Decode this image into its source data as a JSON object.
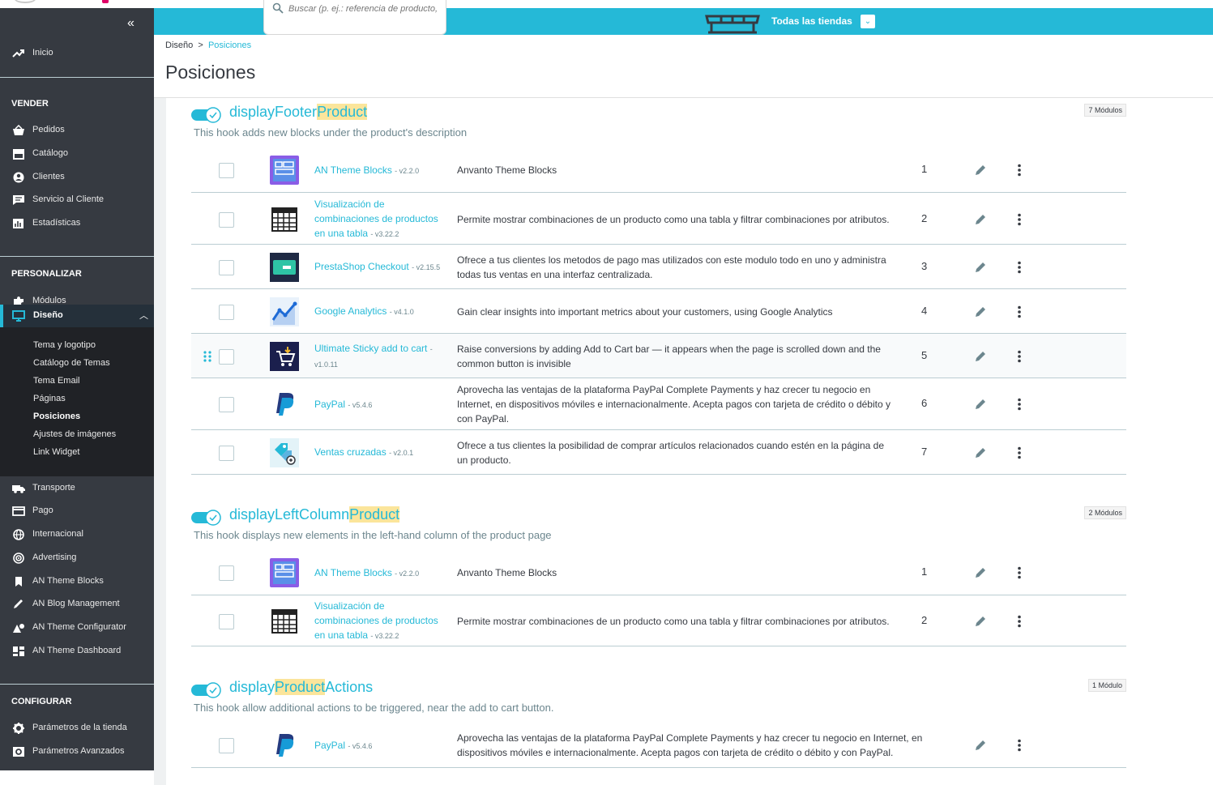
{
  "search": {
    "placeholder": "Buscar (p. ej.: referencia de producto,"
  },
  "header": {
    "shop_label": "Todas las tiendas",
    "shop_dropdown": "⌄"
  },
  "sidebar": {
    "collapse": "«",
    "home": "Inicio",
    "sections": {
      "sell": "VENDER",
      "customize": "PERSONALIZAR",
      "configure": "CONFIGURAR"
    },
    "sell_items": [
      "Pedidos",
      "Catálogo",
      "Clientes",
      "Servicio al Cliente",
      "Estadísticas"
    ],
    "customize_items": [
      "Módulos",
      "Diseño"
    ],
    "design_sub": [
      "Tema y logotipo",
      "Catálogo de Temas",
      "Tema Email",
      "Páginas",
      "Posiciones",
      "Ajustes de imágenes",
      "Link Widget"
    ],
    "other_items": [
      "Transporte",
      "Pago",
      "Internacional",
      "Advertising",
      "AN Theme Blocks",
      "AN Blog Management",
      "AN Theme Configurator",
      "AN Theme Dashboard"
    ],
    "configure_items": [
      "Parámetros de la tienda",
      "Parámetros Avanzados"
    ]
  },
  "breadcrumb": {
    "parent": "Diseño",
    "sep": ">",
    "current": "Posiciones"
  },
  "page_title": "Posiciones",
  "hooks": [
    {
      "name_pre": "displayFooter",
      "name_hl": "Product",
      "name_post": "",
      "desc": "This hook adds new blocks under the product's description",
      "badge": "7 Módulos",
      "rows": [
        {
          "name": "AN Theme Blocks",
          "ver": "- v2.2.0",
          "desc": "Anvanto Theme Blocks",
          "pos": "1",
          "icon": "an-theme-blocks"
        },
        {
          "name": "Visualización de combinaciones de productos en una tabla",
          "ver": "- v3.22.2",
          "desc": "Permite mostrar combinaciones de un producto como una tabla y filtrar combinaciones por atributos.",
          "pos": "2",
          "icon": "table-grid"
        },
        {
          "name": "PrestaShop Checkout",
          "ver": "- v2.15.5",
          "desc": "Ofrece a tus clientes los metodos de pago mas utilizados con este modulo todo en uno y administra todas tus ventas en una interfaz centralizada.",
          "pos": "3",
          "icon": "checkout-card"
        },
        {
          "name": "Google Analytics",
          "ver": "- v4.1.0",
          "desc": "Gain clear insights into important metrics about your customers, using Google Analytics",
          "pos": "4",
          "icon": "analytics-chart"
        },
        {
          "name": "Ultimate Sticky add to cart",
          "ver": "- v1.0.11",
          "desc": "Raise conversions by adding Add to Cart bar — it appears when the page is scrolled down and the common button is invisible",
          "pos": "5",
          "icon": "sticky-cart"
        },
        {
          "name": "PayPal",
          "ver": "- v5.4.6",
          "desc": "Aprovecha las ventajas de la plataforma PayPal Complete Payments y haz crecer tu negocio en Internet, en dispositivos móviles e internacionalmente. Acepta pagos con tarjeta de crédito o débito y con PayPal.",
          "pos": "6",
          "icon": "paypal"
        },
        {
          "name": "Ventas cruzadas",
          "ver": "- v2.0.1",
          "desc": "Ofrece a tus clientes la posibilidad de comprar artículos relacionados cuando estén en la página de un producto.",
          "pos": "7",
          "icon": "cross-selling"
        }
      ]
    },
    {
      "name_pre": "displayLeftColumn",
      "name_hl": "Product",
      "name_post": "",
      "desc": "This hook displays new elements in the left-hand column of the product page",
      "badge": "2 Módulos",
      "rows": [
        {
          "name": "AN Theme Blocks",
          "ver": "- v2.2.0",
          "desc": "Anvanto Theme Blocks",
          "pos": "1",
          "icon": "an-theme-blocks"
        },
        {
          "name": "Visualización de combinaciones de productos en una tabla",
          "ver": "- v3.22.2",
          "desc": "Permite mostrar combinaciones de un producto como una tabla y filtrar combinaciones por atributos.",
          "pos": "2",
          "icon": "table-grid"
        }
      ]
    },
    {
      "name_pre": "display",
      "name_hl": "Product",
      "name_post": "Actions",
      "desc": "This hook allow additional actions to be triggered, near the add to cart button.",
      "badge": "1 Módulo",
      "rows": [
        {
          "name": "PayPal",
          "ver": "- v5.4.6",
          "desc": "Aprovecha las ventajas de la plataforma PayPal Complete Payments y haz crecer tu negocio en Internet, en dispositivos móviles e internacionalmente. Acepta pagos con tarjeta de crédito o débito y con PayPal.",
          "pos": "",
          "icon": "paypal"
        }
      ]
    }
  ],
  "colors": {
    "accent": "#25b9d7",
    "sidebar": "#363a41",
    "highlight": "#fbe59b"
  }
}
